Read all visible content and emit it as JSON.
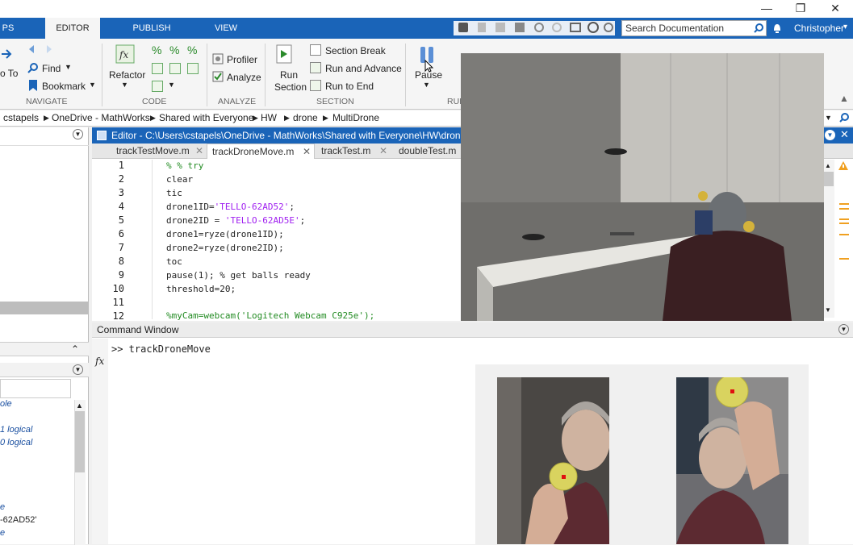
{
  "window": {
    "minimize_glyph": "—",
    "restore_glyph": "❐",
    "close_glyph": "✕"
  },
  "ribbon_tabs": [
    "PS",
    "EDITOR",
    "PUBLISH",
    "VIEW"
  ],
  "search": {
    "placeholder": "Search Documentation"
  },
  "user": {
    "name": "Christopher"
  },
  "ribbon": {
    "navigate": {
      "go_to": "o To",
      "find": "Find",
      "bookmark": "Bookmark",
      "group": "NAVIGATE"
    },
    "code": {
      "refactor": "Refactor",
      "group": "CODE"
    },
    "analyze": {
      "profiler": "Profiler",
      "analyze": "Analyze",
      "group": "ANALYZE"
    },
    "section": {
      "run_section": "Run Section",
      "section_break": "Section Break",
      "run_and_advance": "Run and Advance",
      "run_to_end": "Run to End",
      "group": "SECTION"
    },
    "run": {
      "pause": "Pause",
      "group": "RUI"
    }
  },
  "path": [
    "cstapels",
    "OneDrive - MathWorks",
    "Shared with Everyone",
    "HW",
    "drone",
    "MultiDrone"
  ],
  "editor": {
    "title": "Editor - C:\\Users\\cstapels\\OneDrive - MathWorks\\Shared with Everyone\\HW\\drone\\Mu",
    "tabs": [
      "trackTestMove.m",
      "trackDroneMove.m",
      "trackTest.m",
      "doubleTest.m"
    ],
    "line_numbers": [
      "1",
      "2",
      "3",
      "4",
      "5",
      "6",
      "7",
      "8",
      "9",
      "10",
      "11",
      "12"
    ],
    "lines": [
      "% % try",
      "clear",
      "tic",
      "drone1ID='TELLO-62AD52';",
      "drone2ID = 'TELLO-62AD5E';",
      "drone1=ryze(drone1ID);",
      "drone2=ryze(drone2ID);",
      "toc",
      "pause(1); % get balls ready",
      "threshold=20;",
      "",
      "%myCam=webcam('Logitech Webcam C925e');"
    ]
  },
  "command_window": {
    "title": "Command Window",
    "prompt": ">> trackDroneMove",
    "fx": "fx"
  },
  "workspace": {
    "items": [
      "ole",
      "1 logical",
      "0 logical",
      "e",
      "-62AD52'",
      "e"
    ]
  },
  "colors": {
    "accent": "#1a64b8",
    "string": "#a020f0",
    "comment": "#228b22"
  }
}
